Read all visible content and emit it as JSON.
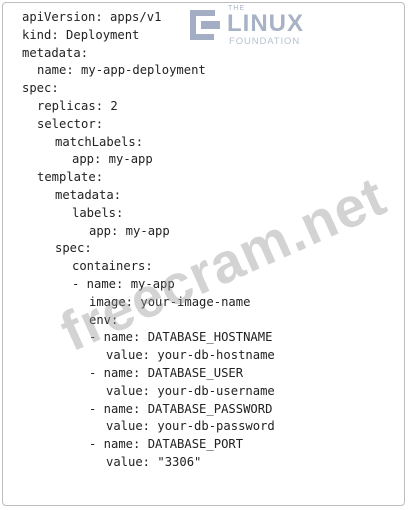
{
  "logo": {
    "small_text": "THE",
    "name": "LINUX",
    "subtitle": "FOUNDATION",
    "icon": "linux-foundation-logo-icon"
  },
  "watermark": "freecram.net",
  "code_lines": [
    "apiVersion: apps/v1",
    "kind: Deployment",
    "metadata:",
    "name: my-app-deployment",
    "spec:",
    "replicas: 2",
    "selector:",
    "matchLabels:",
    "app: my-app",
    "template:",
    "metadata:",
    "labels:",
    "app: my-app",
    "spec:",
    "containers:",
    "- name: my-app",
    "image: your-image-name",
    "env:",
    "- name: DATABASE_HOSTNAME",
    "value: your-db-hostname",
    "- name: DATABASE_USER",
    "value: your-db-username",
    "- name: DATABASE_PASSWORD",
    "value: your-db-password",
    "- name: DATABASE_PORT",
    "value: \"3306\""
  ]
}
